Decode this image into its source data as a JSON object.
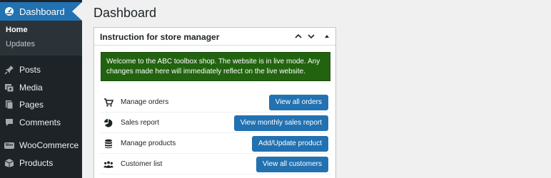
{
  "sidebar": {
    "dashboard_label": "Dashboard",
    "submenu": {
      "home": "Home",
      "updates": "Updates"
    },
    "items": [
      {
        "label": "Posts",
        "icon": "pin-icon"
      },
      {
        "label": "Media",
        "icon": "media-icon"
      },
      {
        "label": "Pages",
        "icon": "pages-icon"
      },
      {
        "label": "Comments",
        "icon": "comment-icon"
      },
      {
        "label": "WooCommerce",
        "icon": "woocommerce-icon",
        "badge_text": "Woo"
      },
      {
        "label": "Products",
        "icon": "products-icon"
      }
    ]
  },
  "page": {
    "title": "Dashboard"
  },
  "panel": {
    "title": "Instruction for store manager",
    "notice": "Welcome to the ABC toolbox shop. The website is in live mode. Any changes made here will immediately reflect on the live website.",
    "rows": [
      {
        "label": "Manage orders",
        "button": "View all orders",
        "icon": "cart-icon"
      },
      {
        "label": "Sales report",
        "button": "View monthly sales report",
        "icon": "pie-chart-icon"
      },
      {
        "label": "Manage products",
        "button": "Add/Update product",
        "icon": "database-icon"
      },
      {
        "label": "Customer list",
        "button": "View all customers",
        "icon": "groups-icon"
      }
    ]
  },
  "colors": {
    "sidebar_bg": "#1d2327",
    "accent": "#2271b1",
    "notice_bg": "#22630f"
  }
}
